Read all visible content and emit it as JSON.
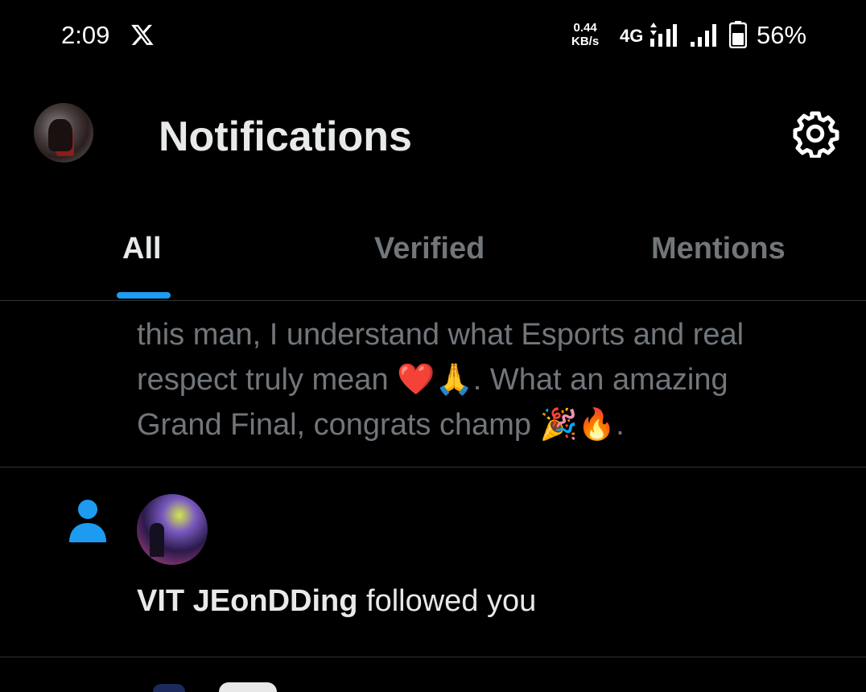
{
  "status_bar": {
    "time": "2:09",
    "net_speed_value": "0.44",
    "net_speed_unit": "KB/s",
    "network_type": "4G",
    "battery_percent": "56%",
    "icons": [
      "x-logo-icon",
      "signal-icon",
      "battery-icon"
    ]
  },
  "header": {
    "title": "Notifications",
    "settings_icon": "gear-icon"
  },
  "tabs": [
    {
      "label": "All",
      "active": true
    },
    {
      "label": "Verified",
      "active": false
    },
    {
      "label": "Mentions",
      "active": false
    }
  ],
  "notifications": [
    {
      "type": "tweet-snippet",
      "lines": [
        "this man, I understand what Esports and real",
        "respect truly mean ❤️🙏. What an amazing",
        "Grand Final, congrats champ 🎉🔥."
      ]
    },
    {
      "type": "follow",
      "icon": "person-icon",
      "name": "VIT JEonDDing",
      "action": "followed you"
    }
  ],
  "colors": {
    "background": "#000000",
    "primary_text": "#e7e9ea",
    "secondary_text": "#71767b",
    "accent": "#1d9bf0",
    "divider": "#2f3336"
  }
}
